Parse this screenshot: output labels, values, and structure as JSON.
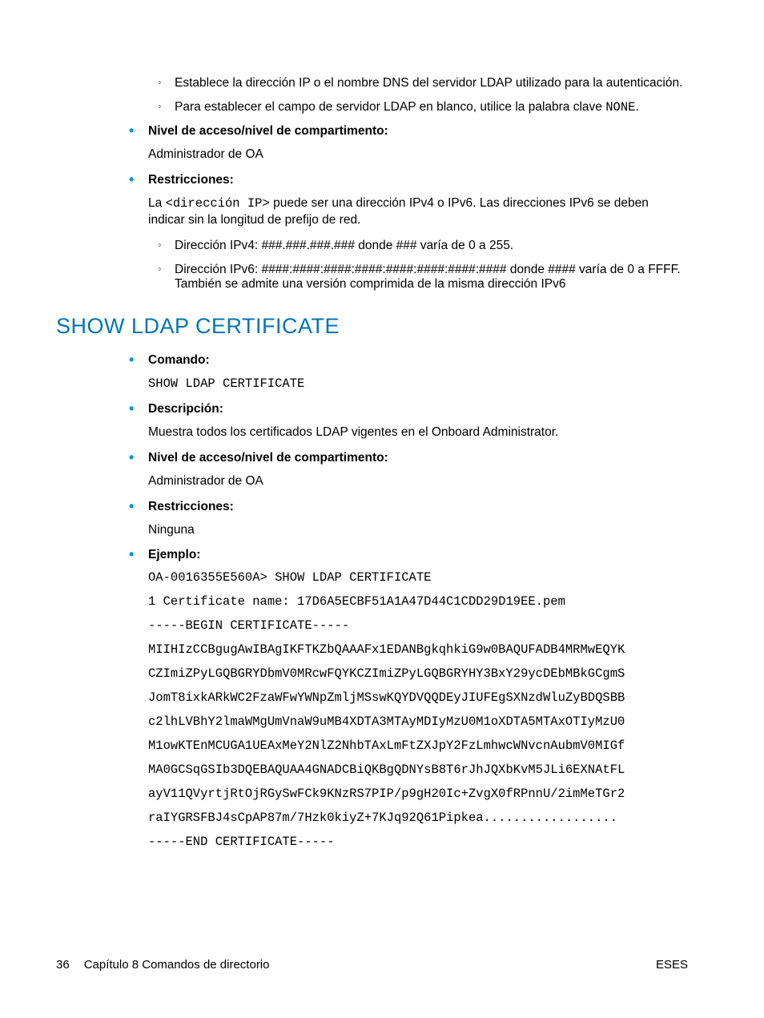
{
  "top_list": {
    "sub": [
      "Establece la dirección IP o el nombre DNS del servidor LDAP utilizado para la autenticación.",
      {
        "prefix": "Para establecer el campo de servidor LDAP en blanco, utilice la palabra clave ",
        "code": "NONE",
        "suffix": "."
      }
    ],
    "items": [
      {
        "label": "Nivel de acceso/nivel de compartimento:",
        "body": "Administrador de OA"
      },
      {
        "label": "Restricciones:",
        "body": {
          "prefix": "La ",
          "code": "<dirección IP>",
          "suffix": " puede ser una dirección IPv4 o IPv6. Las direcciones IPv6 se deben indicar sin la longitud de prefijo de red."
        },
        "sub": [
          "Dirección IPv4: ###.###.###.### donde ### varía de 0 a 255.",
          "Dirección IPv6: ####:####:####:####:####:####:####:#### donde #### varía de 0 a FFFF. También se admite una versión comprimida de la misma dirección IPv6"
        ]
      }
    ]
  },
  "section": {
    "heading": "SHOW LDAP CERTIFICATE",
    "items": [
      {
        "label": "Comando:",
        "code": "SHOW LDAP CERTIFICATE"
      },
      {
        "label": "Descripción:",
        "body": "Muestra todos los certificados LDAP vigentes en el Onboard Administrator."
      },
      {
        "label": "Nivel de acceso/nivel de compartimento:",
        "body": "Administrador de OA"
      },
      {
        "label": "Restricciones:",
        "body": "Ninguna"
      },
      {
        "label": "Ejemplo:"
      }
    ],
    "example_lines": [
      "OA-0016355E560A> SHOW LDAP CERTIFICATE",
      "1 Certificate name: 17D6A5ECBF51A1A47D44C1CDD29D19EE.pem",
      "-----BEGIN CERTIFICATE-----",
      "MIIHIzCCBgugAwIBAgIKFTKZbQAAAFx1EDANBgkqhkiG9w0BAQUFADB4MRMwEQYK",
      "CZImiZPyLGQBGRYDbmV0MRcwFQYKCZImiZPyLGQBGRYHY3BxY29ycDEbMBkGCgmS",
      "JomT8ixkARkWC2FzaWFwYWNpZmljMSswKQYDVQQDEyJIUFEgSXNzdWluZyBDQSBB",
      "c2lhLVBhY2lmaWMgUmVnaW9uMB4XDTA3MTAyMDIyMzU0M1oXDTA5MTAxOTIyMzU0",
      "M1owKTEnMCUGA1UEAxMeY2NlZ2NhbTAxLmFtZXJpY2FzLmhwcWNvcnAubmV0MIGf",
      "MA0GCSqGSIb3DQEBAQUAA4GNADCBiQKBgQDNYsB8T6rJhJQXbKvM5JLi6EXNAtFL",
      "ayV11QVyrtjRtOjRGySwFCk9KNzRS7PIP/p9gH20Ic+ZvgX0fRPnnU/2imMeTGr2",
      "raIYGRSFBJ4sCpAP87m/7Hzk0kiyZ+7KJq92Q61Pipkea..................",
      "-----END CERTIFICATE-----"
    ]
  },
  "footer": {
    "page": "36",
    "chapter": "Capítulo 8   Comandos de directorio",
    "right": "ESES"
  }
}
